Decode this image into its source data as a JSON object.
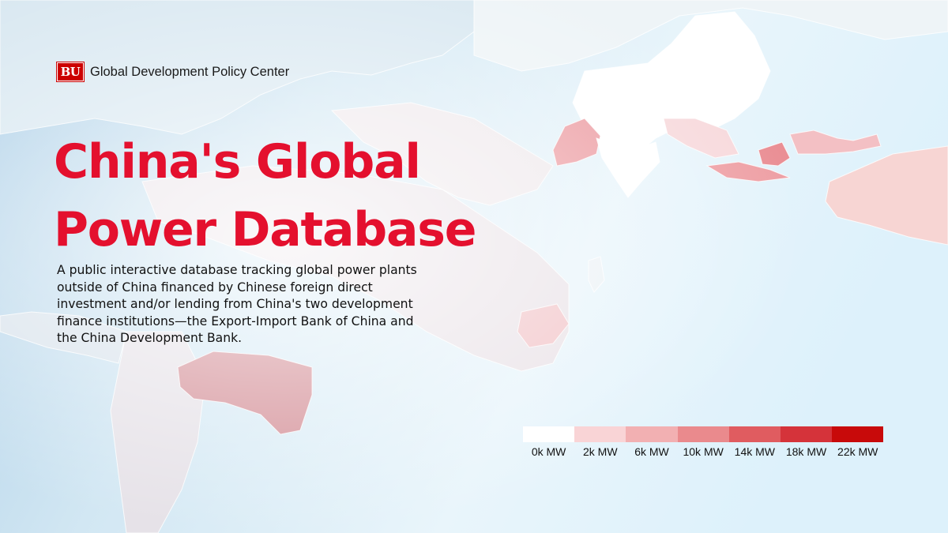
{
  "brand": {
    "logo_text": "BU",
    "name": "Global Development Policy Center"
  },
  "title": {
    "line1": "China's Global",
    "line2": "Power Database"
  },
  "description": "A public interactive database tracking global power plants outside of China financed by Chinese foreign direct investment and/or lending from China's two development finance institutions—the Export-Import Bank of China and the China Development Bank.",
  "legend": {
    "items": [
      {
        "label": "0k MW",
        "color": "#ffffff"
      },
      {
        "label": "2k MW",
        "color": "#f9d4d6"
      },
      {
        "label": "6k MW",
        "color": "#f2b0b2"
      },
      {
        "label": "10k MW",
        "color": "#ea8a8d"
      },
      {
        "label": "14k MW",
        "color": "#e05c60"
      },
      {
        "label": "18k MW",
        "color": "#d5333a"
      },
      {
        "label": "22k MW",
        "color": "#c80a0a"
      }
    ]
  },
  "colors": {
    "accent": "#e4102e",
    "brand": "#cc0000"
  }
}
